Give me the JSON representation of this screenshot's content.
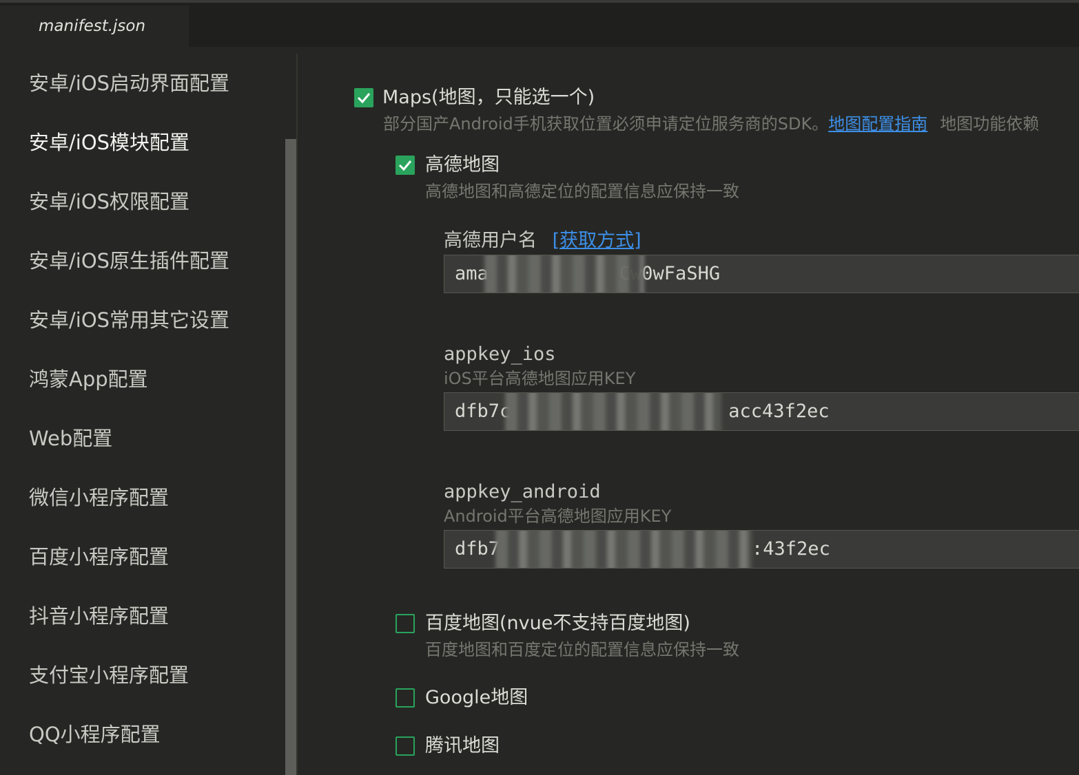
{
  "tab": {
    "title": "manifest.json"
  },
  "sidebar": {
    "items": [
      {
        "label": "安卓/iOS启动界面配置",
        "active": false
      },
      {
        "label": "安卓/iOS模块配置",
        "active": true
      },
      {
        "label": "安卓/iOS权限配置",
        "active": false
      },
      {
        "label": "安卓/iOS原生插件配置",
        "active": false
      },
      {
        "label": "安卓/iOS常用其它设置",
        "active": false
      },
      {
        "label": "鸿蒙App配置",
        "active": false
      },
      {
        "label": "Web配置",
        "active": false
      },
      {
        "label": "微信小程序配置",
        "active": false
      },
      {
        "label": "百度小程序配置",
        "active": false
      },
      {
        "label": "抖音小程序配置",
        "active": false
      },
      {
        "label": "支付宝小程序配置",
        "active": false
      },
      {
        "label": "QQ小程序配置",
        "active": false
      }
    ]
  },
  "maps": {
    "checked": true,
    "label": "Maps(地图，只能选一个)",
    "desc_prefix": "部分国产Android手机获取位置必须申请定位服务商的SDK。",
    "guide_link": "地图配置指南",
    "desc_suffix": "地图功能依赖"
  },
  "amap": {
    "checked": true,
    "label": "高德地图",
    "desc": "高德地图和高德定位的配置信息应保持一致",
    "username": {
      "label": "高德用户名",
      "link": "[获取方式]",
      "value_start": "ama",
      "value_end": "Cw0wFaSHG"
    },
    "appkey_ios": {
      "label": "appkey_ios",
      "hint": "iOS平台高德地图应用KEY",
      "value_start": "dfb7c",
      "value_end": "acc43f2ec"
    },
    "appkey_android": {
      "label": "appkey_android",
      "hint": "Android平台高德地图应用KEY",
      "value_start": "dfb7",
      "value_end": ":43f2ec"
    }
  },
  "baidu": {
    "checked": false,
    "label": "百度地图(nvue不支持百度地图)",
    "desc": "百度地图和百度定位的配置信息应保持一致"
  },
  "google": {
    "checked": false,
    "label": "Google地图"
  },
  "tencent": {
    "checked": false,
    "label": "腾讯地图"
  },
  "colors": {
    "accent_green": "#2aa35d",
    "link_blue": "#3d8fe8",
    "background": "#262724"
  }
}
